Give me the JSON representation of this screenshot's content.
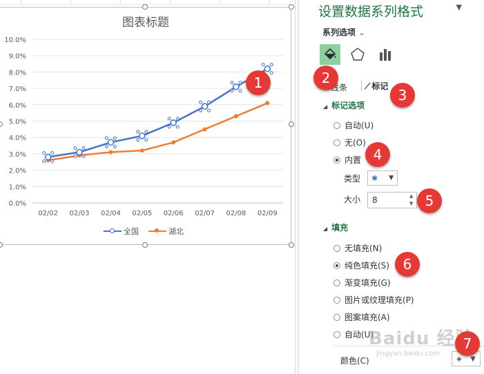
{
  "chart_data": {
    "type": "line",
    "title": "图表标题",
    "categories": [
      "02/02",
      "02/03",
      "02/04",
      "02/05",
      "02/06",
      "02/07",
      "02/08",
      "02/09"
    ],
    "y_tick_labels": [
      "0.0%",
      "1.0%",
      "2.0%",
      "3.0%",
      "4.0%",
      "5.0%",
      "6.0%",
      "7.0%",
      "8.0%",
      "9.0%",
      "10.0%"
    ],
    "ylim": [
      0,
      10
    ],
    "grid": true,
    "legend_position": "bottom",
    "series": [
      {
        "name": "全国",
        "color": "#4472c4",
        "values": [
          2.8,
          3.1,
          3.7,
          4.1,
          4.9,
          5.9,
          7.1,
          8.2
        ],
        "marker": "hollow",
        "selected": true
      },
      {
        "name": "湖北",
        "color": "#ed7d31",
        "values": [
          2.6,
          2.9,
          3.1,
          3.2,
          3.7,
          4.5,
          5.3,
          6.1
        ],
        "marker": "filled"
      }
    ]
  },
  "pane": {
    "title": "设置数据系列格式",
    "collapse_icon": "caret-down-icon",
    "series_options": "系列选项",
    "tabs": {
      "line": "线条",
      "marker": "标记"
    },
    "marker_section": "标记选项",
    "marker_options": [
      {
        "label": "自动(U)",
        "selected": false
      },
      {
        "label": "无(O)",
        "selected": false
      },
      {
        "label": "内置",
        "selected": true
      }
    ],
    "type_label": "类型",
    "size_label": "大小",
    "size_value": "8",
    "fill_section": "填充",
    "fill_options": [
      {
        "label": "无填充(N)",
        "selected": false
      },
      {
        "label": "纯色填充(S)",
        "selected": true
      },
      {
        "label": "渐变填充(G)",
        "selected": false
      },
      {
        "label": "图片或纹理填充(P)",
        "selected": false
      },
      {
        "label": "图案填充(A)",
        "selected": false
      },
      {
        "label": "自动(U)",
        "selected": false
      }
    ],
    "color_label": "颜色(C)",
    "accent": "#217346"
  },
  "badges": [
    "1",
    "2",
    "3",
    "4",
    "5",
    "6",
    "7"
  ],
  "watermark": {
    "main": "Baidu 经验",
    "sub": "jingyan.baidu.com"
  }
}
